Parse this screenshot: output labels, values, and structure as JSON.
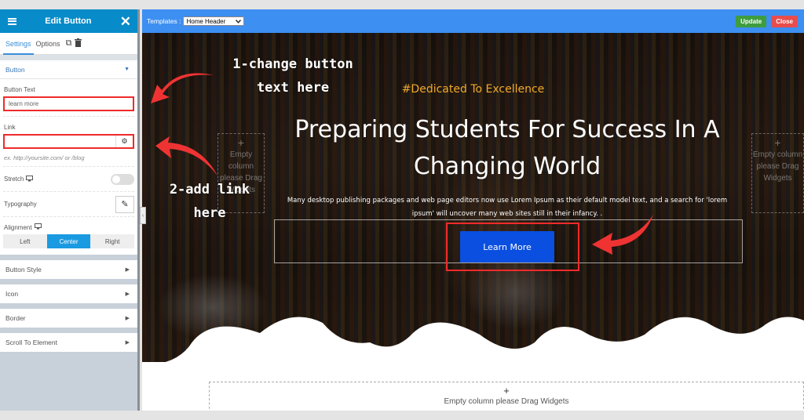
{
  "sidebar": {
    "title": "Edit Button",
    "tabs": [
      {
        "label": "Settings",
        "active": true
      },
      {
        "label": "Options",
        "active": false
      }
    ],
    "section_button": "Button",
    "button_text_label": "Button Text",
    "button_text_value": "learn more",
    "link_label": "Link",
    "link_value": "",
    "link_hint": "ex. http://yoursite.com/ or /blog",
    "stretch_label": "Stretch",
    "typography_label": "Typography",
    "alignment_label": "Alignment",
    "alignment_options": [
      {
        "label": "Left",
        "active": false
      },
      {
        "label": "Center",
        "active": true
      },
      {
        "label": "Right",
        "active": false
      }
    ],
    "collapsed_sections": [
      "Button Style",
      "Icon",
      "Border",
      "Scroll To Element"
    ]
  },
  "topbar": {
    "templates_label": "Templates :",
    "template_selected": "Home Header",
    "update_label": "Update",
    "close_label": "Close"
  },
  "hero": {
    "tagline": "#Dedicated To Excellence",
    "headline": "Preparing Students For Success In A Changing World",
    "paragraph": "Many desktop publishing packages and web page editors now use Lorem Ipsum as their default model text, and a search for 'lorem ipsum' will uncover many web sites still in their infancy. .",
    "button_label": "Learn More"
  },
  "empty_column": {
    "plus": "+",
    "text": "Empty column please Drag Widgets"
  },
  "annotations": {
    "step1": "1-change button text here",
    "step2": "2-add link here"
  },
  "icons": {
    "menu": "☰",
    "close": "✕",
    "copy": "⧉",
    "trash": "🗑",
    "caret_down": "▼",
    "caret_right": "▶",
    "gear": "⚙",
    "pencil": "✎",
    "monitor": "🖵",
    "chevron_down": "⌄",
    "chevron_left": "‹"
  },
  "colors": {
    "sidebar_header": "#078bc9",
    "topbar": "#3d8ff2",
    "active_tab": "#3a8fd9",
    "alignment_active": "#1a9ae0",
    "update_button": "#3e9d3e",
    "close_button": "#e84c4c",
    "tagline": "#f0a92a",
    "cta_button": "#0a4fe0",
    "annotation_red": "#ef2b2b"
  }
}
